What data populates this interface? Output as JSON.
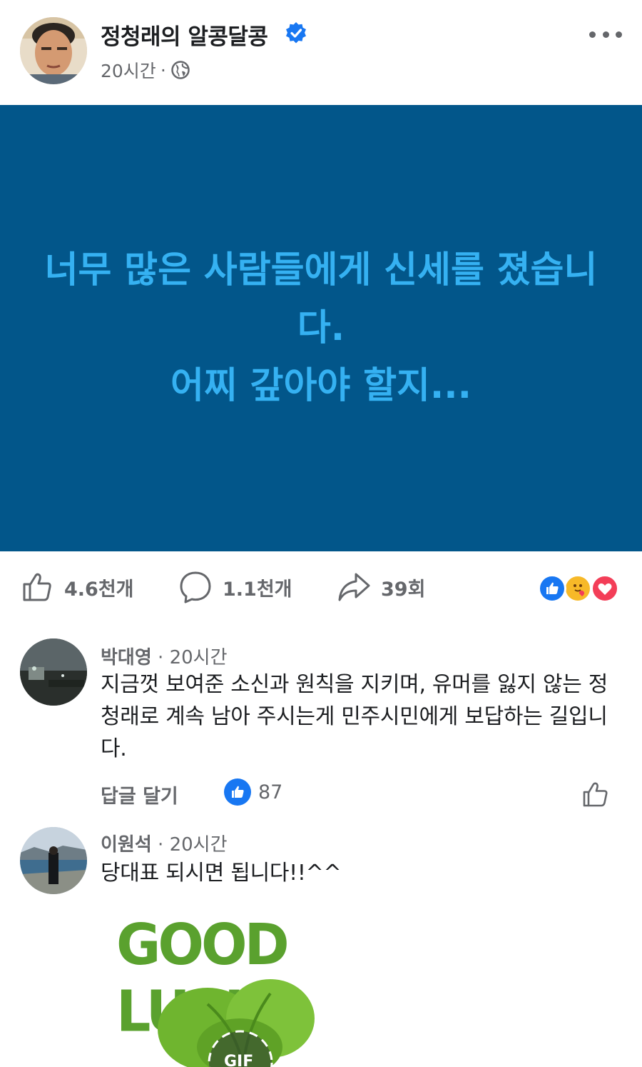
{
  "post": {
    "author": "정청래의 알콩달콩",
    "time": "20시간",
    "separator": "·",
    "icons": {
      "verified": "verified-badge-icon",
      "audience": "globe-icon",
      "more": "more-options-icon"
    },
    "text_lines": [
      "너무 많은 사람들에게 신세를 졌습니",
      "다.",
      "어찌 갚아야 할지..."
    ],
    "background_color": "#02568a",
    "text_color": "#35b1f2"
  },
  "actions": {
    "like_count": "4.6천개",
    "comment_count": "1.1천개",
    "share_count": "39회",
    "reactions": [
      "like-reaction-icon",
      "care-reaction-icon",
      "love-reaction-icon"
    ]
  },
  "comments": [
    {
      "name": "박대영",
      "time": "20시간",
      "text": "지금껏 보여준 소신과  원칙을 지키며, 유머를 잃지 않는 정청래로 계속 남아 주시는게 민주시민에게 보답하는 길입니다.",
      "reply_label": "답글 달기",
      "like_count": "87"
    },
    {
      "name": "이원석",
      "time": "20시간",
      "text": "당대표 되시면 됩니다!!^^",
      "gif_text": "GOOD LUCK",
      "gif_badge": "GIF"
    }
  ]
}
